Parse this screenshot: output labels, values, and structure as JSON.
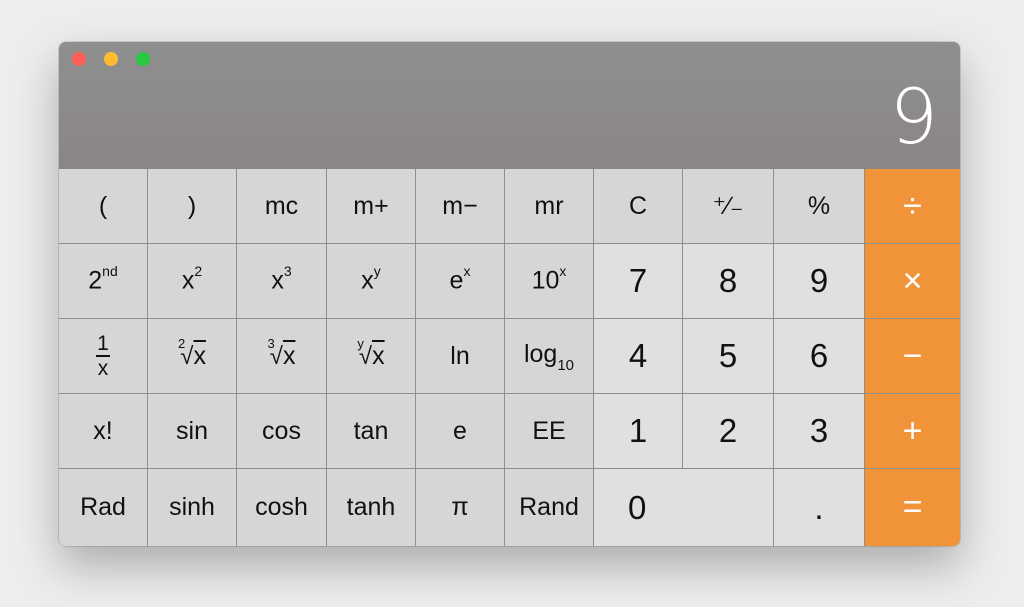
{
  "window": {
    "controls": [
      "close",
      "minimize",
      "zoom"
    ]
  },
  "display": {
    "value": "9"
  },
  "colors": {
    "operator": "#f19439",
    "display_bg": "#8f8f8f",
    "key_bg": "#d6d6d6",
    "digit_bg": "#e0e0e0"
  },
  "keys": {
    "open_paren": "(",
    "close_paren": ")",
    "mc": "mc",
    "m_plus": "m+",
    "m_minus": "m−",
    "mr": "mr",
    "clear": "C",
    "sign": "⁺∕₋",
    "percent": "%",
    "divide": "÷",
    "second_base": "2",
    "second_sup": "nd",
    "x_squared_base": "x",
    "x_squared_sup": "2",
    "x_cubed_base": "x",
    "x_cubed_sup": "3",
    "x_y_base": "x",
    "x_y_sup": "y",
    "e_x_base": "e",
    "e_x_sup": "x",
    "ten_x_base": "10",
    "ten_x_sup": "x",
    "seven": "7",
    "eight": "8",
    "nine": "9",
    "multiply": "×",
    "recip_num": "1",
    "recip_den": "x",
    "sqrt2_index": "2",
    "sqrt3_index": "3",
    "sqrty_index": "y",
    "radical": "√",
    "radicand": "x",
    "ln": "ln",
    "log_base": "log",
    "log_sub": "10",
    "four": "4",
    "five": "5",
    "six": "6",
    "subtract": "−",
    "factorial": "x!",
    "sin": "sin",
    "cos": "cos",
    "tan": "tan",
    "e": "e",
    "ee": "EE",
    "one": "1",
    "two": "2",
    "three": "3",
    "add": "+",
    "rad": "Rad",
    "sinh": "sinh",
    "cosh": "cosh",
    "tanh": "tanh",
    "pi": "π",
    "rand": "Rand",
    "zero": "0",
    "decimal": ".",
    "equals": "="
  }
}
